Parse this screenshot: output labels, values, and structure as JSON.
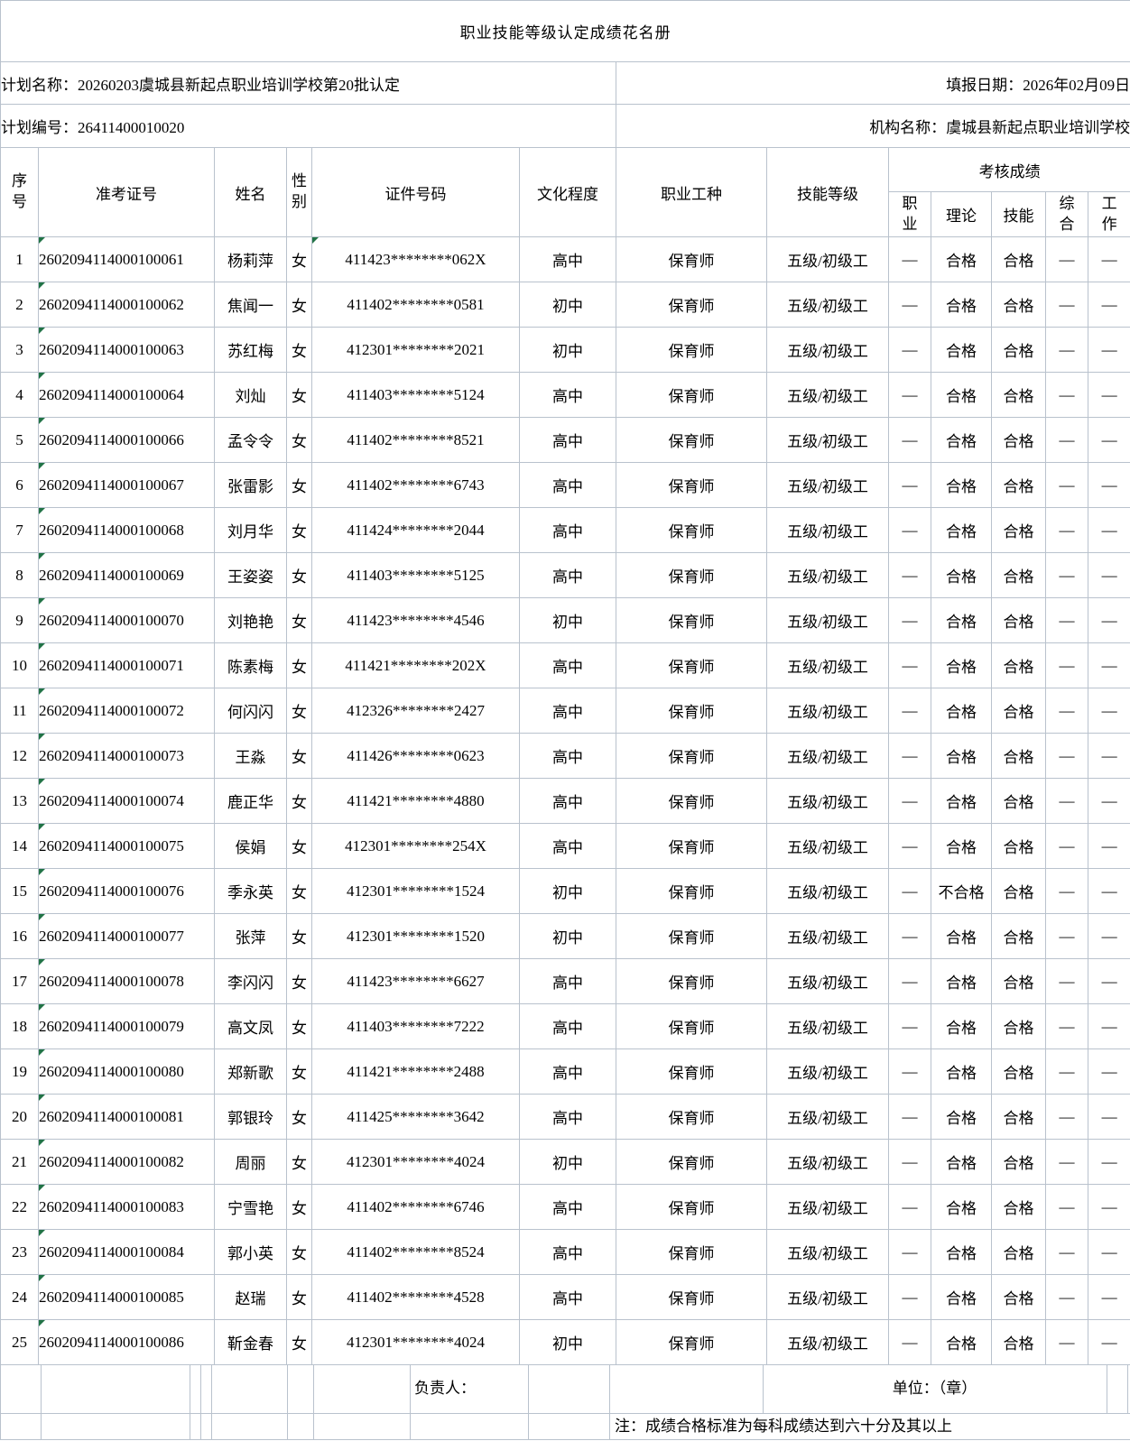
{
  "title": "职业技能等级认定成绩花名册",
  "meta": {
    "plan_name_label": "计划名称：",
    "plan_name_value": "20260203虞城县新起点职业培训学校第20批认定",
    "report_date_label": "填报日期：",
    "report_date_value": "2026年02月09日",
    "plan_code_label": "计划编号：",
    "plan_code_value": "26411400010020",
    "org_name_label": "机构名称：",
    "org_name_value": "虞城县新起点职业培训学校"
  },
  "table": {
    "headers": {
      "seq": "序\n号",
      "exam_no": "准考证号",
      "name": "姓名",
      "gender": "性\n别",
      "id_no": "证件号码",
      "education": "文化程度",
      "occupation": "职业工种",
      "level": "技能等级",
      "score_group": "考核成绩"
    },
    "score_cols": [
      "职\n业",
      "理论",
      "技能",
      "综\n合",
      "工\n作"
    ]
  },
  "rows": [
    {
      "seq": "1",
      "exam_no": "2602094114000100061",
      "name": "杨莉萍",
      "gender": "女",
      "id_no": "411423********062X",
      "education": "高中",
      "occupation": "保育师",
      "level": "五级/初级工",
      "id_flag": true,
      "marks": [
        "—",
        "合格",
        "合格",
        "—",
        "—"
      ]
    },
    {
      "seq": "2",
      "exam_no": "2602094114000100062",
      "name": "焦闻一",
      "gender": "女",
      "id_no": "411402********0581",
      "education": "初中",
      "occupation": "保育师",
      "level": "五级/初级工",
      "id_flag": false,
      "marks": [
        "—",
        "合格",
        "合格",
        "—",
        "—"
      ]
    },
    {
      "seq": "3",
      "exam_no": "2602094114000100063",
      "name": "苏红梅",
      "gender": "女",
      "id_no": "412301********2021",
      "education": "初中",
      "occupation": "保育师",
      "level": "五级/初级工",
      "id_flag": false,
      "marks": [
        "—",
        "合格",
        "合格",
        "—",
        "—"
      ]
    },
    {
      "seq": "4",
      "exam_no": "2602094114000100064",
      "name": "刘灿",
      "gender": "女",
      "id_no": "411403********5124",
      "education": "高中",
      "occupation": "保育师",
      "level": "五级/初级工",
      "id_flag": false,
      "marks": [
        "—",
        "合格",
        "合格",
        "—",
        "—"
      ]
    },
    {
      "seq": "5",
      "exam_no": "2602094114000100066",
      "name": "孟令令",
      "gender": "女",
      "id_no": "411402********8521",
      "education": "高中",
      "occupation": "保育师",
      "level": "五级/初级工",
      "id_flag": false,
      "marks": [
        "—",
        "合格",
        "合格",
        "—",
        "—"
      ]
    },
    {
      "seq": "6",
      "exam_no": "2602094114000100067",
      "name": "张雷影",
      "gender": "女",
      "id_no": "411402********6743",
      "education": "高中",
      "occupation": "保育师",
      "level": "五级/初级工",
      "id_flag": false,
      "marks": [
        "—",
        "合格",
        "合格",
        "—",
        "—"
      ]
    },
    {
      "seq": "7",
      "exam_no": "2602094114000100068",
      "name": "刘月华",
      "gender": "女",
      "id_no": "411424********2044",
      "education": "高中",
      "occupation": "保育师",
      "level": "五级/初级工",
      "id_flag": false,
      "marks": [
        "—",
        "合格",
        "合格",
        "—",
        "—"
      ]
    },
    {
      "seq": "8",
      "exam_no": "2602094114000100069",
      "name": "王姿姿",
      "gender": "女",
      "id_no": "411403********5125",
      "education": "高中",
      "occupation": "保育师",
      "level": "五级/初级工",
      "id_flag": false,
      "marks": [
        "—",
        "合格",
        "合格",
        "—",
        "—"
      ]
    },
    {
      "seq": "9",
      "exam_no": "2602094114000100070",
      "name": "刘艳艳",
      "gender": "女",
      "id_no": "411423********4546",
      "education": "初中",
      "occupation": "保育师",
      "level": "五级/初级工",
      "id_flag": false,
      "marks": [
        "—",
        "合格",
        "合格",
        "—",
        "—"
      ]
    },
    {
      "seq": "10",
      "exam_no": "2602094114000100071",
      "name": "陈素梅",
      "gender": "女",
      "id_no": "411421********202X",
      "education": "高中",
      "occupation": "保育师",
      "level": "五级/初级工",
      "id_flag": false,
      "marks": [
        "—",
        "合格",
        "合格",
        "—",
        "—"
      ]
    },
    {
      "seq": "11",
      "exam_no": "2602094114000100072",
      "name": "何闪闪",
      "gender": "女",
      "id_no": "412326********2427",
      "education": "高中",
      "occupation": "保育师",
      "level": "五级/初级工",
      "id_flag": false,
      "marks": [
        "—",
        "合格",
        "合格",
        "—",
        "—"
      ]
    },
    {
      "seq": "12",
      "exam_no": "2602094114000100073",
      "name": "王淼",
      "gender": "女",
      "id_no": "411426********0623",
      "education": "高中",
      "occupation": "保育师",
      "level": "五级/初级工",
      "id_flag": false,
      "marks": [
        "—",
        "合格",
        "合格",
        "—",
        "—"
      ]
    },
    {
      "seq": "13",
      "exam_no": "2602094114000100074",
      "name": "鹿正华",
      "gender": "女",
      "id_no": "411421********4880",
      "education": "高中",
      "occupation": "保育师",
      "level": "五级/初级工",
      "id_flag": false,
      "marks": [
        "—",
        "合格",
        "合格",
        "—",
        "—"
      ]
    },
    {
      "seq": "14",
      "exam_no": "2602094114000100075",
      "name": "侯娟",
      "gender": "女",
      "id_no": "412301********254X",
      "education": "高中",
      "occupation": "保育师",
      "level": "五级/初级工",
      "id_flag": false,
      "marks": [
        "—",
        "合格",
        "合格",
        "—",
        "—"
      ]
    },
    {
      "seq": "15",
      "exam_no": "2602094114000100076",
      "name": "季永英",
      "gender": "女",
      "id_no": "412301********1524",
      "education": "初中",
      "occupation": "保育师",
      "level": "五级/初级工",
      "id_flag": false,
      "marks": [
        "—",
        "不合格",
        "合格",
        "—",
        "—"
      ]
    },
    {
      "seq": "16",
      "exam_no": "2602094114000100077",
      "name": "张萍",
      "gender": "女",
      "id_no": "412301********1520",
      "education": "初中",
      "occupation": "保育师",
      "level": "五级/初级工",
      "id_flag": false,
      "marks": [
        "—",
        "合格",
        "合格",
        "—",
        "—"
      ]
    },
    {
      "seq": "17",
      "exam_no": "2602094114000100078",
      "name": "李闪闪",
      "gender": "女",
      "id_no": "411423********6627",
      "education": "高中",
      "occupation": "保育师",
      "level": "五级/初级工",
      "id_flag": false,
      "marks": [
        "—",
        "合格",
        "合格",
        "—",
        "—"
      ]
    },
    {
      "seq": "18",
      "exam_no": "2602094114000100079",
      "name": "高文凤",
      "gender": "女",
      "id_no": "411403********7222",
      "education": "高中",
      "occupation": "保育师",
      "level": "五级/初级工",
      "id_flag": false,
      "marks": [
        "—",
        "合格",
        "合格",
        "—",
        "—"
      ]
    },
    {
      "seq": "19",
      "exam_no": "2602094114000100080",
      "name": "郑新歌",
      "gender": "女",
      "id_no": "411421********2488",
      "education": "高中",
      "occupation": "保育师",
      "level": "五级/初级工",
      "id_flag": false,
      "marks": [
        "—",
        "合格",
        "合格",
        "—",
        "—"
      ]
    },
    {
      "seq": "20",
      "exam_no": "2602094114000100081",
      "name": "郭银玲",
      "gender": "女",
      "id_no": "411425********3642",
      "education": "高中",
      "occupation": "保育师",
      "level": "五级/初级工",
      "id_flag": false,
      "marks": [
        "—",
        "合格",
        "合格",
        "—",
        "—"
      ]
    },
    {
      "seq": "21",
      "exam_no": "2602094114000100082",
      "name": "周丽",
      "gender": "女",
      "id_no": "412301********4024",
      "education": "初中",
      "occupation": "保育师",
      "level": "五级/初级工",
      "id_flag": false,
      "marks": [
        "—",
        "合格",
        "合格",
        "—",
        "—"
      ]
    },
    {
      "seq": "22",
      "exam_no": "2602094114000100083",
      "name": "宁雪艳",
      "gender": "女",
      "id_no": "411402********6746",
      "education": "高中",
      "occupation": "保育师",
      "level": "五级/初级工",
      "id_flag": false,
      "marks": [
        "—",
        "合格",
        "合格",
        "—",
        "—"
      ]
    },
    {
      "seq": "23",
      "exam_no": "2602094114000100084",
      "name": "郭小英",
      "gender": "女",
      "id_no": "411402********8524",
      "education": "高中",
      "occupation": "保育师",
      "level": "五级/初级工",
      "id_flag": false,
      "marks": [
        "—",
        "合格",
        "合格",
        "—",
        "—"
      ]
    },
    {
      "seq": "24",
      "exam_no": "2602094114000100085",
      "name": "赵瑞",
      "gender": "女",
      "id_no": "411402********4528",
      "education": "高中",
      "occupation": "保育师",
      "level": "五级/初级工",
      "id_flag": false,
      "marks": [
        "—",
        "合格",
        "合格",
        "—",
        "—"
      ]
    },
    {
      "seq": "25",
      "exam_no": "2602094114000100086",
      "name": "靳金春",
      "gender": "女",
      "id_no": "412301********4024",
      "education": "初中",
      "occupation": "保育师",
      "level": "五级/初级工",
      "id_flag": false,
      "marks": [
        "—",
        "合格",
        "合格",
        "—",
        "—"
      ]
    }
  ],
  "footer": {
    "person_label": "负责人：",
    "unit_label": "单位：（章）",
    "note": "注：成绩合格标准为每科成绩达到六十分及其以上"
  },
  "colors": {
    "grid_line": "#b9c2cd",
    "error_triangle_green": "#217346",
    "text": "#000000"
  }
}
